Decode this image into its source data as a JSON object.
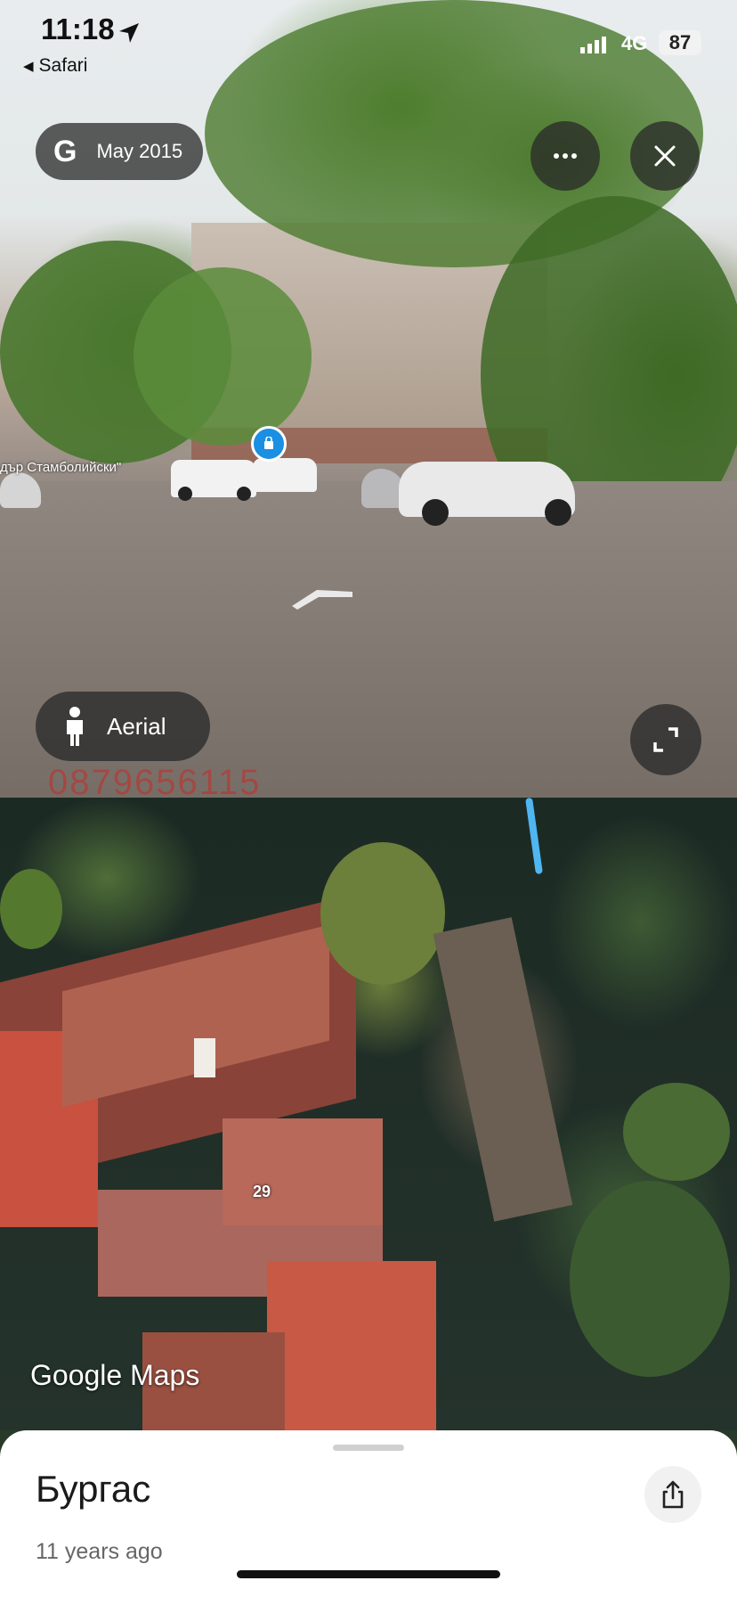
{
  "status_bar": {
    "time": "11:18",
    "back_app": "Safari",
    "network": "4G",
    "battery": "87"
  },
  "street_view": {
    "date_label": "May 2015",
    "street_sign": "дър Стамболийски\"",
    "mode_button": "Aerial",
    "watermark": "0879656115"
  },
  "aerial": {
    "house_number": "29",
    "brand": "Google Maps"
  },
  "sheet": {
    "title": "Бургас",
    "subtitle": "11 years ago"
  },
  "icons": {
    "g_logo": "google-g-icon",
    "more": "more-dots-icon",
    "close": "close-icon",
    "pegman": "pegman-icon",
    "expand": "expand-icon",
    "share": "share-icon",
    "location_pin": "shopping-bag-pin-icon",
    "nav_arrow": "navigation-arrow-icon"
  },
  "colors": {
    "overlay_bg": "#282828",
    "nav_line": "#4fb6f0",
    "pin": "#1a8fe3"
  }
}
